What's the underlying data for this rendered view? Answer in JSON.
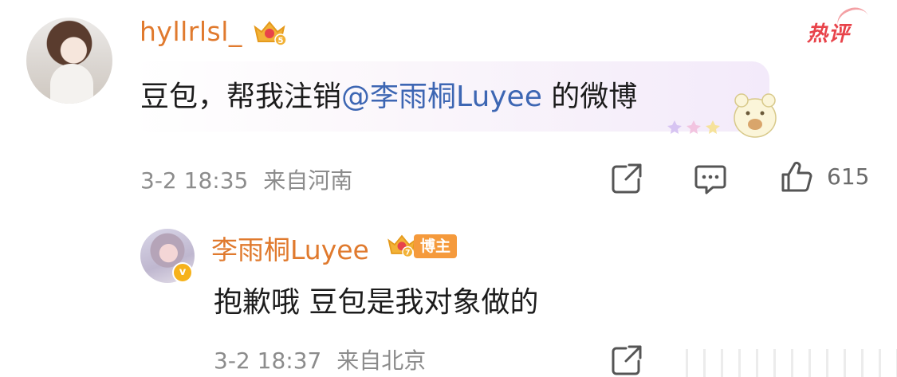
{
  "comment": {
    "username": "hyllrlsl_",
    "level": "5",
    "hot_label": "热评",
    "text_before": "豆包，帮我注销",
    "mention": "@李雨桐Luyee",
    "text_after": " 的微博",
    "time": "3-2 18:35",
    "location": "来自河南",
    "likes": "615"
  },
  "reply": {
    "username": "李雨桐Luyee",
    "level": "7",
    "author_tag": "博主",
    "text": "抱歉哦 豆包是我对象做的",
    "time": "3-2 18:37",
    "location": "来自北京"
  },
  "colors": {
    "username": "#e07a2e",
    "mention": "#3d66b3",
    "hot": "#e8434a",
    "meta": "#8c8c8c",
    "author_tag": "#f59a3c",
    "verified": "#f6b21b"
  },
  "icons": [
    "crown-icon",
    "share-icon",
    "comment-icon",
    "like-icon",
    "verified-icon",
    "sticker-icon"
  ]
}
